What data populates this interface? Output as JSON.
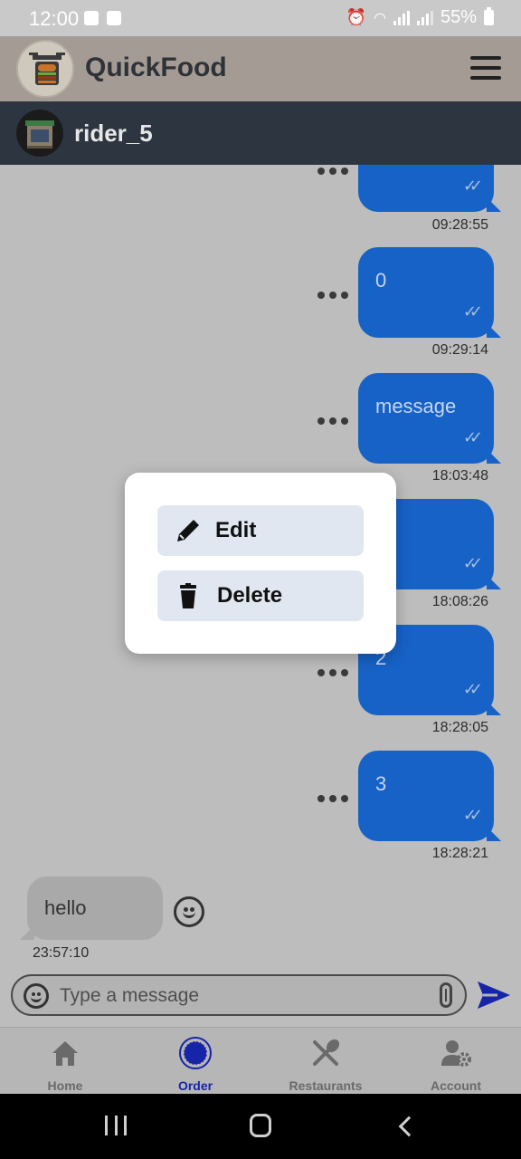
{
  "status_bar": {
    "time": "12:00",
    "battery": "55%"
  },
  "app": {
    "title": "QuickFood",
    "logo_icon": "burger-bag-logo",
    "menu_icon": "hamburger-menu-icon"
  },
  "chat": {
    "contact_name": "rider_5",
    "contact_avatar": "restaurant-storefront-avatar"
  },
  "messages": {
    "outgoing": [
      {
        "text": "",
        "time": "09:28:55"
      },
      {
        "text": "0",
        "time": "09:29:14"
      },
      {
        "text": "message",
        "time": "18:03:48"
      },
      {
        "text": "",
        "time": "18:08:26"
      },
      {
        "text": "2",
        "time": "18:28:05"
      },
      {
        "text": "3",
        "time": "18:28:21"
      }
    ],
    "incoming": [
      {
        "text": "hello",
        "time": "23:57:10"
      }
    ]
  },
  "composer": {
    "placeholder": "Type a message",
    "value": ""
  },
  "context_menu": {
    "edit_label": "Edit",
    "delete_label": "Delete"
  },
  "bottom_nav": {
    "items": [
      {
        "label": "Home",
        "icon": "home-icon",
        "active": false
      },
      {
        "label": "Order",
        "icon": "order-icon",
        "active": true
      },
      {
        "label": "Restaurants",
        "icon": "fork-spoon-icon",
        "active": false
      },
      {
        "label": "Account",
        "icon": "user-settings-icon",
        "active": false
      }
    ]
  },
  "colors": {
    "outgoing_bubble": "#1662c6",
    "active_nav": "#1624a8",
    "header": "#a59b95",
    "chat_header": "#2d3640"
  }
}
